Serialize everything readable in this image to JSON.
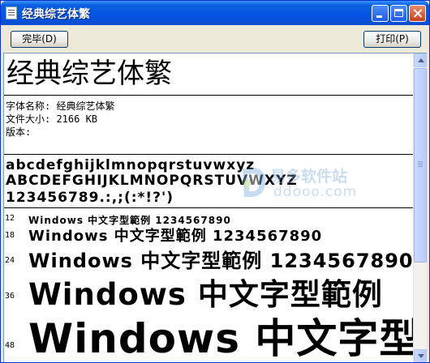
{
  "window": {
    "title": "经典综艺体繁",
    "buttons": {
      "done": "完毕(D)",
      "print": "打印(P)"
    }
  },
  "preview": {
    "font_name": "经典综艺体繁",
    "info": [
      "字体名称: 经典综艺体繁",
      "文件大小: 2166 KB",
      "版本:"
    ],
    "charset": {
      "lower": "abcdefghijklmnopqrstuvwxyz",
      "upper": "ABCDEFGHIJKLMNOPQRSTUVWXYZ",
      "digits": "123456789.:,;(:*!?')"
    },
    "samples": [
      {
        "size": "12",
        "text": "Windows 中文字型範例 1234567890"
      },
      {
        "size": "18",
        "text": "Windows 中文字型範例 1234567890"
      },
      {
        "size": "24",
        "text": "Windows 中文字型範例 1234567890"
      },
      {
        "size": "36",
        "text": "Windows 中文字型範例"
      },
      {
        "size": "48",
        "text": "Windows 中文字型範例"
      }
    ]
  },
  "watermark": {
    "text": "易多软件站",
    "url": "ddooo.com"
  },
  "colors": {
    "titlebar": "#0654e3",
    "window_bg": "#ece9d8",
    "watermark": "#8cb4dc"
  }
}
